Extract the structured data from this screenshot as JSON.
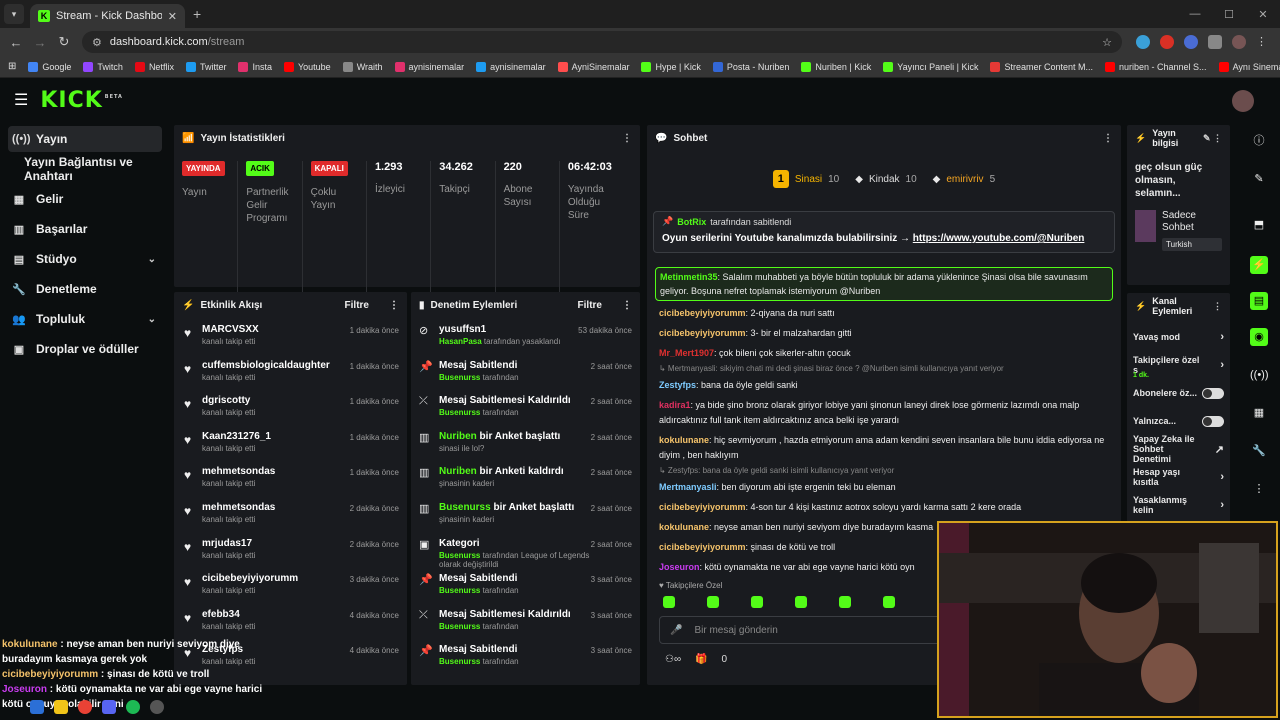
{
  "browser": {
    "tab_title": "Stream - Kick Dashboard",
    "url_host": "dashboard.kick.com",
    "url_path": "/stream",
    "bookmarks": [
      "Google",
      "Twitch",
      "Netflix",
      "Twitter",
      "Insta",
      "Youtube",
      "Wraith",
      "aynisinemalar",
      "aynisinemalar",
      "AyniSinemalar",
      "Hype | Kick",
      "Posta - Nuriben",
      "Nuriben | Kick",
      "Yayıncı Paneli | Kick",
      "Streamer Content M...",
      "nuriben - Channel S...",
      "Aynı Sinemalar - Ça..."
    ]
  },
  "sidebar": {
    "items": [
      {
        "label": "Yayın",
        "icon": "broadcast-icon"
      },
      {
        "label": "Yayın Bağlantısı ve Anahtarı",
        "icon": ""
      },
      {
        "label": "Gelir",
        "icon": "revenue-icon"
      },
      {
        "label": "Başarılar",
        "icon": "achievements-icon"
      },
      {
        "label": "Stüdyo",
        "icon": "studio-icon"
      },
      {
        "label": "Denetleme",
        "icon": "wrench-icon"
      },
      {
        "label": "Topluluk",
        "icon": "community-icon"
      },
      {
        "label": "Droplar ve ödüller",
        "icon": "drops-icon"
      }
    ]
  },
  "stats": {
    "title": "Yayın İstatistikleri",
    "items": [
      {
        "badge": "YAYINDA",
        "badge_color": "#e02b2b",
        "label": "Yayın"
      },
      {
        "badge": "ACIK",
        "badge_color": "#53fc18",
        "label": "Partnerlik Gelir Programı"
      },
      {
        "badge": "KAPALI",
        "badge_color": "#e02b2b",
        "label": "Çoklu Yayın"
      },
      {
        "num": "1.293",
        "label": "İzleyici"
      },
      {
        "num": "34.262",
        "label": "Takipçi"
      },
      {
        "num": "220",
        "label": "Abone Sayısı"
      },
      {
        "num": "06:42:03",
        "label": "Yayında Olduğu Süre"
      }
    ]
  },
  "events": {
    "title": "Etkinlik Akışı",
    "filter": "Filtre",
    "items": [
      {
        "name": "MARCVSXX",
        "sub": "kanalı takip etti",
        "time": "1 dakika önce"
      },
      {
        "name": "cuffemsbiologicaldaughter",
        "sub": "kanalı takip etti",
        "time": "1 dakika önce"
      },
      {
        "name": "dgriscotty",
        "sub": "kanalı takip etti",
        "time": "1 dakika önce"
      },
      {
        "name": "Kaan231276_1",
        "sub": "kanalı takip etti",
        "time": "1 dakika önce"
      },
      {
        "name": "mehmetsondas",
        "sub": "kanalı takip etti",
        "time": "1 dakika önce"
      },
      {
        "name": "mehmetsondas",
        "sub": "kanalı takip etti",
        "time": "2 dakika önce"
      },
      {
        "name": "mrjudas17",
        "sub": "kanalı takip etti",
        "time": "2 dakika önce"
      },
      {
        "name": "cicibebeyiyiyorumm",
        "sub": "kanalı takip etti",
        "time": "3 dakika önce"
      },
      {
        "name": "efebb34",
        "sub": "kanalı takip etti",
        "time": "4 dakika önce"
      },
      {
        "name": "Zestyfps",
        "sub": "kanalı takip etti",
        "time": "4 dakika önce"
      }
    ]
  },
  "mod": {
    "title": "Denetim Eylemleri",
    "filter": "Filtre",
    "items": [
      {
        "t1": "yusuffsn1",
        "g": "HasanPasa",
        "s": " tarafından yasaklandı",
        "time": "53 dakika önce",
        "icon": "ban-icon"
      },
      {
        "t1": "Mesaj Sabitlendi",
        "g": "Busenurss",
        "s": " tarafından",
        "time": "2 saat önce",
        "icon": "pin-icon"
      },
      {
        "t1": "Mesaj Sabitlemesi Kaldırıldı",
        "g": "Busenurss",
        "s": " tarafından",
        "time": "2 saat önce",
        "icon": "unpin-icon"
      },
      {
        "t0": "Nuriben",
        "t1": " bir Anket başlattı",
        "g": "",
        "s": "sinasi ile lol?",
        "time": "2 saat önce",
        "icon": "poll-icon"
      },
      {
        "t0": "Nuriben",
        "t1": " bir Anketi kaldırdı",
        "g": "",
        "s": "şinasinin kaderi",
        "time": "2 saat önce",
        "icon": "poll-icon"
      },
      {
        "t0": "Busenurss",
        "t1": " bir Anket başlattı",
        "g": "",
        "s": "şinasinin kaderi",
        "time": "2 saat önce",
        "icon": "poll-icon"
      },
      {
        "t1": "Kategori",
        "g": "Busenurss",
        "s": " tarafından League of Legends olarak değiştirildi",
        "time": "2 saat önce",
        "icon": "category-icon"
      },
      {
        "t1": "Mesaj Sabitlendi",
        "g": "Busenurss",
        "s": " tarafından",
        "time": "3 saat önce",
        "icon": "pin-icon"
      },
      {
        "t1": "Mesaj Sabitlemesi Kaldırıldı",
        "g": "Busenurss",
        "s": " tarafından",
        "time": "3 saat önce",
        "icon": "unpin-icon"
      },
      {
        "t1": "Mesaj Sabitlendi",
        "g": "Busenurss",
        "s": " tarafından",
        "time": "3 saat önce",
        "icon": "pin-icon"
      }
    ]
  },
  "chat": {
    "title": "Sohbet",
    "top": [
      {
        "name": "Sinasi",
        "count": "10",
        "color": "#f5b400"
      },
      {
        "name": "Kindak",
        "count": "10",
        "color": "#ddd"
      },
      {
        "name": "emirivriv",
        "count": "5",
        "color": "#f5a623"
      }
    ],
    "pinned_by": "BotRix",
    "pinned_suffix": "tarafından sabitlendi",
    "pinned_text": "Oyun serilerini Youtube kanalımızda bulabilirsiniz → ",
    "pinned_link": "https://www.youtube.com/@Nuriben",
    "highlight_user": "Metinmetin35",
    "highlight_text": ": Salalım muhabbeti ya böyle bütün topluluk bir adama yüklenince Şinasi olsa bile savunasım geliyor. Boşuna nefret toplamak istemiyorum @Nuriben",
    "messages": [
      {
        "user": "cicibebeyiyiyorumm",
        "color": "#f5c36b",
        "text": ": 2-qiyana da nuri sattı"
      },
      {
        "user": "cicibebeyiyiyorumm",
        "color": "#f5c36b",
        "text": ": 3- bir el malzahardan gitti"
      },
      {
        "user": "Mr_Mert1907",
        "color": "#e03030",
        "text": ": çok bileni çok sikerler-altın çocuk"
      },
      {
        "reply": "↳ Mertmanyasli: sikiyim chati mi dedi şinasi biraz önce ? @Nuriben isimli kullanıcıya yanıt veriyor"
      },
      {
        "user": "Zestyfps",
        "color": "#7ecbff",
        "text": ": bana da öyle geldi sanki"
      },
      {
        "user": "kadira1",
        "color": "#e03060",
        "text": ": ya bide şino bronz olarak giriyor lobiye yani şinonun laneyi direk lose görmeniz lazımdı ona malp aldırcaktınız full tank item aldırcaktınız anca belki işe yarardı"
      },
      {
        "user": "kokulunane",
        "color": "#f5c36b",
        "text": ": hiç sevmiyorum , hazda etmiyorum ama adam kendini seven insanlara bile bunu iddia ediyorsa ne diyim , ben haklıyım"
      },
      {
        "reply": "↳ Zestyfps: bana da öyle geldi sanki isimli kullanıcıya yanıt veriyor"
      },
      {
        "user": "Mertmanyasli",
        "color": "#7ecbff",
        "text": ": ben diyorum abi işte ergenin teki bu eleman"
      },
      {
        "user": "cicibebeyiyiyorumm",
        "color": "#f5c36b",
        "text": ": 4-son tur 4 kişi kastınız aotrox soloyu yardı karma sattı 2 kere orada"
      },
      {
        "user": "kokulunane",
        "color": "#f5c36b",
        "text": ": neyse aman ben nuriyi seviyom diye buradayım kasma"
      },
      {
        "user": "cicibebeyiyiyorumm",
        "color": "#f5c36b",
        "text": ": şinası de kötü ve troll"
      },
      {
        "user": "Joseuron",
        "color": "#c93cf0",
        "text": ": kötü oynamakta ne var abi ege vayne harici kötü oyn"
      }
    ],
    "followers_only": "Takipçilere Özel",
    "input_placeholder": "Bir mesaj gönderin",
    "count": "0"
  },
  "info": {
    "title": "Yayın bilgisi",
    "text": "geç olsun güç olmasın, selamın...",
    "category": "Sadece Sohbet",
    "lang": "Turkish"
  },
  "kanal": {
    "title": "Kanal Eylemleri",
    "rows": [
      {
        "label": "Yavaş mod",
        "type": "arrow"
      },
      {
        "label": "Takipçilere özel s",
        "sub": "1 dk.",
        "type": "arrow"
      },
      {
        "label": "Abonelere öz...",
        "type": "toggle"
      },
      {
        "label": "Yalnızca...",
        "type": "toggle"
      },
      {
        "label": "Yapay Zeka ile Sohbet Denetimi",
        "type": "ext"
      },
      {
        "label": "Hesap yaşı kısıtla",
        "type": "arrow"
      },
      {
        "label": "Yasaklanmış kelin",
        "type": "arrow"
      }
    ]
  },
  "overlay": [
    {
      "user": "kokulunane",
      "color": "#f5c36b",
      "text": " : neyse aman ben nuriyi seviyom diye buradayım kasmaya gerek yok"
    },
    {
      "user": "cicibebeyiyiyorumm",
      "color": "#f5c36b",
      "text": " : şinası de kötü ve troll"
    },
    {
      "user": "Joseuron",
      "color": "#c93cf0",
      "text": " : kötü oynamakta ne var abi ege vayne harici kötü oynuyor olabilir yani"
    }
  ]
}
